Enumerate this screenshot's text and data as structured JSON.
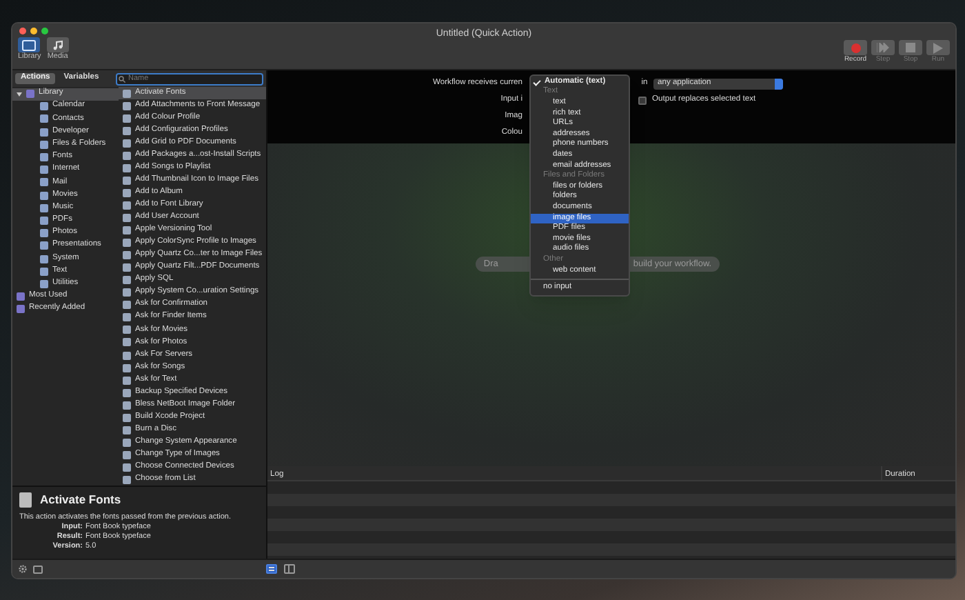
{
  "window": {
    "title": "Untitled (Quick Action)"
  },
  "toolbar_left": [
    {
      "label": "Library",
      "kind": "library",
      "selected": true
    },
    {
      "label": "Media",
      "kind": "media",
      "selected": false
    }
  ],
  "toolbar_right": [
    {
      "label": "Record",
      "kind": "record",
      "disabled": false
    },
    {
      "label": "Step",
      "kind": "step",
      "disabled": true
    },
    {
      "label": "Stop",
      "kind": "stop",
      "disabled": true
    },
    {
      "label": "Run",
      "kind": "run",
      "disabled": true
    }
  ],
  "library_tabs": [
    {
      "label": "Actions",
      "selected": true
    },
    {
      "label": "Variables",
      "selected": false
    }
  ],
  "search": {
    "placeholder": "Name"
  },
  "library_tree": [
    {
      "label": "Library",
      "selected": true,
      "expanded": true,
      "children": [
        {
          "label": "Calendar",
          "selected": false
        },
        {
          "label": "Contacts",
          "selected": false
        },
        {
          "label": "Developer",
          "selected": false
        },
        {
          "label": "Files & Folders",
          "selected": false
        },
        {
          "label": "Fonts",
          "selected": false
        },
        {
          "label": "Internet",
          "selected": false
        },
        {
          "label": "Mail",
          "selected": false
        },
        {
          "label": "Movies",
          "selected": false
        },
        {
          "label": "Music",
          "selected": false
        },
        {
          "label": "PDFs",
          "selected": false
        },
        {
          "label": "Photos",
          "selected": false
        },
        {
          "label": "Presentations",
          "selected": false
        },
        {
          "label": "System",
          "selected": false
        },
        {
          "label": "Text",
          "selected": false
        },
        {
          "label": "Utilities",
          "selected": false
        }
      ]
    },
    {
      "label": "Most Used",
      "selected": false
    },
    {
      "label": "Recently Added",
      "selected": false
    }
  ],
  "actions": [
    {
      "label": "Activate Fonts",
      "selected": true
    },
    {
      "label": "Add Attachments to Front Message",
      "selected": false
    },
    {
      "label": "Add Colour Profile",
      "selected": false
    },
    {
      "label": "Add Configuration Profiles",
      "selected": false
    },
    {
      "label": "Add Grid to PDF Documents",
      "selected": false
    },
    {
      "label": "Add Packages a...ost-Install Scripts",
      "selected": false
    },
    {
      "label": "Add Songs to Playlist",
      "selected": false
    },
    {
      "label": "Add Thumbnail Icon to Image Files",
      "selected": false
    },
    {
      "label": "Add to Album",
      "selected": false
    },
    {
      "label": "Add to Font Library",
      "selected": false
    },
    {
      "label": "Add User Account",
      "selected": false
    },
    {
      "label": "Apple Versioning Tool",
      "selected": false
    },
    {
      "label": "Apply ColorSync Profile to Images",
      "selected": false
    },
    {
      "label": "Apply Quartz Co...ter to Image Files",
      "selected": false
    },
    {
      "label": "Apply Quartz Filt...PDF Documents",
      "selected": false
    },
    {
      "label": "Apply SQL",
      "selected": false
    },
    {
      "label": "Apply System Co...uration Settings",
      "selected": false
    },
    {
      "label": "Ask for Confirmation",
      "selected": false
    },
    {
      "label": "Ask for Finder Items",
      "selected": false
    },
    {
      "label": "Ask for Movies",
      "selected": false
    },
    {
      "label": "Ask for Photos",
      "selected": false
    },
    {
      "label": "Ask For Servers",
      "selected": false
    },
    {
      "label": "Ask for Songs",
      "selected": false
    },
    {
      "label": "Ask for Text",
      "selected": false
    },
    {
      "label": "Backup Specified Devices",
      "selected": false
    },
    {
      "label": "Bless NetBoot Image Folder",
      "selected": false
    },
    {
      "label": "Build Xcode Project",
      "selected": false
    },
    {
      "label": "Burn a Disc",
      "selected": false
    },
    {
      "label": "Change System Appearance",
      "selected": false
    },
    {
      "label": "Change Type of Images",
      "selected": false
    },
    {
      "label": "Choose Connected Devices",
      "selected": false
    },
    {
      "label": "Choose from List",
      "selected": false
    }
  ],
  "description": {
    "title": "Activate Fonts",
    "text": "This action activates the fonts passed from the previous action.",
    "fields": [
      {
        "label": "Input:",
        "value": "Font Book typeface"
      },
      {
        "label": "Result:",
        "value": "Font Book typeface"
      },
      {
        "label": "Version:",
        "value": "5.0"
      }
    ]
  },
  "config": {
    "receives_label": "Workflow receives curren",
    "in_label": "in",
    "application": "any application",
    "input_label": "Input i",
    "output_replaces": {
      "label": "Output replaces selected text",
      "checked": false
    },
    "image_label": "Imag",
    "colour_label": "Colou"
  },
  "menu": [
    {
      "kind": "item",
      "label": "Automatic (text)",
      "checked": true,
      "selected": false
    },
    {
      "kind": "header",
      "label": "Text"
    },
    {
      "kind": "item",
      "label": "text",
      "checked": false,
      "selected": false
    },
    {
      "kind": "item",
      "label": "rich text",
      "checked": false,
      "selected": false
    },
    {
      "kind": "item",
      "label": "URLs",
      "checked": false,
      "selected": false
    },
    {
      "kind": "item",
      "label": "addresses",
      "checked": false,
      "selected": false
    },
    {
      "kind": "item",
      "label": "phone numbers",
      "checked": false,
      "selected": false
    },
    {
      "kind": "item",
      "label": "dates",
      "checked": false,
      "selected": false
    },
    {
      "kind": "item",
      "label": "email addresses",
      "checked": false,
      "selected": false
    },
    {
      "kind": "header",
      "label": "Files and Folders"
    },
    {
      "kind": "item",
      "label": "files or folders",
      "checked": false,
      "selected": false
    },
    {
      "kind": "item",
      "label": "folders",
      "checked": false,
      "selected": false
    },
    {
      "kind": "item",
      "label": "documents",
      "checked": false,
      "selected": false
    },
    {
      "kind": "item",
      "label": "image files",
      "checked": false,
      "selected": true
    },
    {
      "kind": "item",
      "label": "PDF files",
      "checked": false,
      "selected": false
    },
    {
      "kind": "item",
      "label": "movie files",
      "checked": false,
      "selected": false
    },
    {
      "kind": "item",
      "label": "audio files",
      "checked": false,
      "selected": false
    },
    {
      "kind": "header",
      "label": "Other"
    },
    {
      "kind": "item",
      "label": "web content",
      "checked": false,
      "selected": false
    },
    {
      "kind": "separator"
    },
    {
      "kind": "top",
      "label": "no input",
      "checked": false,
      "selected": false
    }
  ],
  "canvas": {
    "hint_left": "Dra",
    "hint_right": "build your workflow."
  },
  "log": {
    "columns": [
      "Log",
      "Duration"
    ]
  },
  "log_view_buttons": [
    {
      "kind": "list",
      "selected": true
    },
    {
      "kind": "split",
      "selected": false
    }
  ]
}
